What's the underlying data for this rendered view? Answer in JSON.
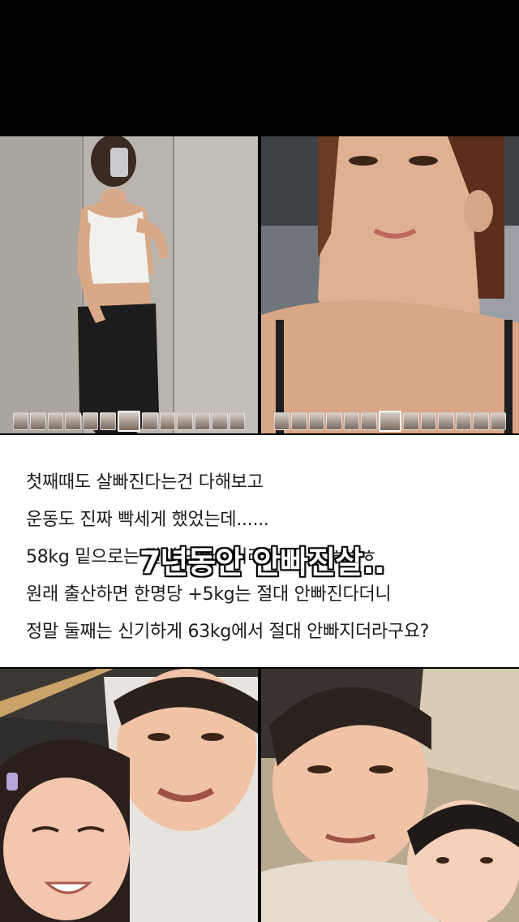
{
  "text_block": {
    "lines": [
      "첫째때도 살빠진다는건 다해보고",
      "운동도 진짜 빡세게 했었는데......",
      "58kg 밑으로는 절대 안빠지더라구요..... ㅎㅎㅎ",
      "원래 출산하면 한명당 +5kg는 절대 안빠진다더니",
      "정말 둘째는 신기하게 63kg에서 절대 안빠지더라구요?"
    ]
  },
  "caption_overlay": "7년동안 안빠진살..",
  "photos": [
    {
      "name": "mirror-selfie-photo"
    },
    {
      "name": "closeup-selfie-photo"
    },
    {
      "name": "father-daughter-selfie-photo"
    },
    {
      "name": "father-baby-selfie-photo"
    }
  ]
}
